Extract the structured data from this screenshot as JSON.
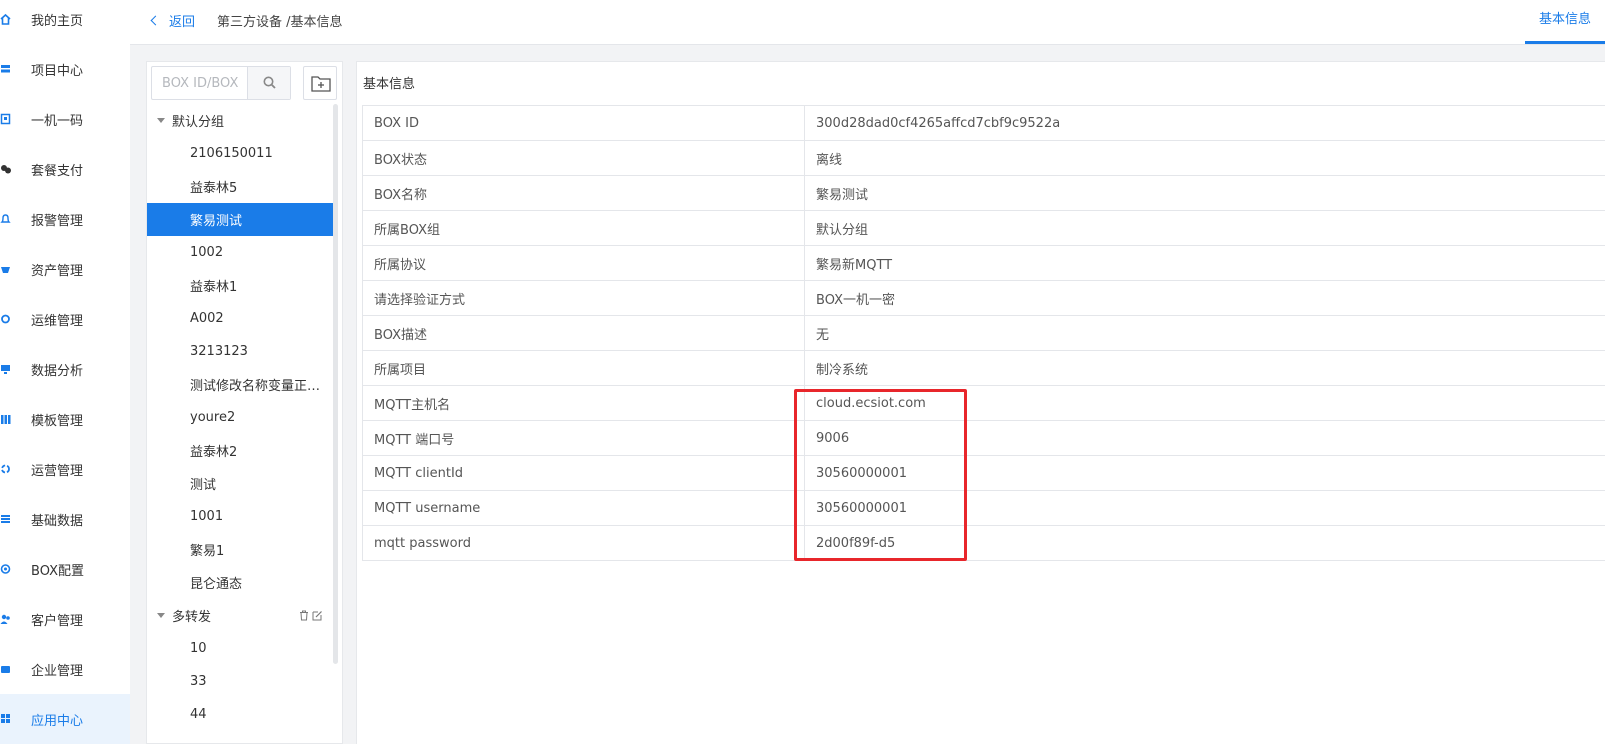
{
  "sidebar": {
    "items": [
      {
        "label": "我的主页",
        "icon": "home-icon"
      },
      {
        "label": "项目中心",
        "icon": "project-icon"
      },
      {
        "label": "一机一码",
        "icon": "qrcode-icon"
      },
      {
        "label": "套餐支付",
        "icon": "payment-icon"
      },
      {
        "label": "报警管理",
        "icon": "bell-icon"
      },
      {
        "label": "资产管理",
        "icon": "asset-icon"
      },
      {
        "label": "运维管理",
        "icon": "maintenance-icon"
      },
      {
        "label": "数据分析",
        "icon": "monitor-icon"
      },
      {
        "label": "模板管理",
        "icon": "template-icon"
      },
      {
        "label": "运营管理",
        "icon": "operation-icon"
      },
      {
        "label": "基础数据",
        "icon": "data-icon"
      },
      {
        "label": "BOX配置",
        "icon": "box-config-icon"
      },
      {
        "label": "客户管理",
        "icon": "customer-icon"
      },
      {
        "label": "企业管理",
        "icon": "enterprise-icon"
      },
      {
        "label": "应用中心",
        "icon": "apps-icon"
      }
    ],
    "active_index": 14
  },
  "header": {
    "back_label": "返回",
    "breadcrumb": "第三方设备 /基本信息",
    "tab_label": "基本信息"
  },
  "groups_panel": {
    "search_placeholder": "BOX ID/BOX",
    "groups": [
      {
        "name": "默认分组",
        "items": [
          "2106150011",
          "益泰林5",
          "繁易测试",
          "1002",
          "益泰林1",
          "A002",
          "3213123",
          "测试修改名称变量正…",
          "youre2",
          "益泰林2",
          "测试",
          "1001",
          "繁易1",
          "昆仑通态"
        ],
        "selected_index": 2
      },
      {
        "name": "多转发",
        "items": [
          "10",
          "33",
          "44"
        ],
        "selected_index": -1
      }
    ]
  },
  "info": {
    "title": "基本信息",
    "rows": [
      {
        "key": "BOX ID",
        "value": "300d28dad0cf4265affcd7cbf9c9522a",
        "style": ""
      },
      {
        "key": "BOX状态",
        "value": "离线",
        "style": "red"
      },
      {
        "key": "BOX名称",
        "value": "繁易测试",
        "style": "blue"
      },
      {
        "key": "所属BOX组",
        "value": "默认分组",
        "style": "blue"
      },
      {
        "key": "所属协议",
        "value": "繁易新MQTT",
        "style": "blue"
      },
      {
        "key": "请选择验证方式",
        "value": "BOX一机一密",
        "style": ""
      },
      {
        "key": "BOX描述",
        "value": "无",
        "style": "blue"
      },
      {
        "key": "所属项目",
        "value": "制冷系统",
        "style": ""
      },
      {
        "key": "MQTT主机名",
        "value": "cloud.ecsiot.com",
        "style": ""
      },
      {
        "key": "MQTT 端口号",
        "value": "9006",
        "style": ""
      },
      {
        "key": "MQTT clientId",
        "value": "30560000001",
        "style": ""
      },
      {
        "key": "MQTT username",
        "value": "30560000001",
        "style": ""
      },
      {
        "key": "mqtt password",
        "value": "2d00f89f-d5",
        "style": ""
      }
    ]
  },
  "colors": {
    "accent": "#1a7ce8",
    "offline": "#e02020",
    "annotation": "#e8262b"
  }
}
